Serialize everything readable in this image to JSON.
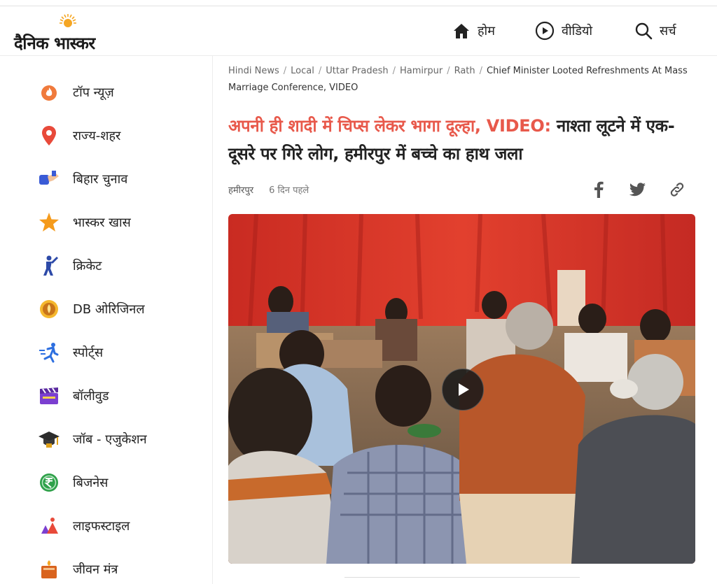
{
  "logo": {
    "text": "दैनिक भास्कर"
  },
  "nav": [
    {
      "label": "होम",
      "icon": "home-icon"
    },
    {
      "label": "वीडियो",
      "icon": "play-circle-icon"
    },
    {
      "label": "सर्च",
      "icon": "search-icon"
    }
  ],
  "sidebar": {
    "items": [
      {
        "label": "टॉप न्यूज़",
        "icon": "fire-icon"
      },
      {
        "label": "राज्य-शहर",
        "icon": "location-pin-icon"
      },
      {
        "label": "बिहार चुनाव",
        "icon": "election-hand-icon"
      },
      {
        "label": "भास्कर खास",
        "icon": "star-icon"
      },
      {
        "label": "क्रिकेट",
        "icon": "cricket-icon"
      },
      {
        "label": "DB ओरिजिनल",
        "icon": "db-original-icon"
      },
      {
        "label": "स्पोर्ट्स",
        "icon": "runner-icon"
      },
      {
        "label": "बॉलीवुड",
        "icon": "clapperboard-icon"
      },
      {
        "label": "जॉब - एजुकेशन",
        "icon": "graduation-cap-icon"
      },
      {
        "label": "बिजनेस",
        "icon": "rupee-icon"
      },
      {
        "label": "लाइफस्टाइल",
        "icon": "lifestyle-icon"
      },
      {
        "label": "जीवन मंत्र",
        "icon": "book-icon"
      }
    ]
  },
  "breadcrumb": {
    "items": [
      "Hindi News",
      "Local",
      "Uttar Pradesh",
      "Hamirpur",
      "Rath"
    ],
    "current": "Chief Minister Looted Refreshments At Mass Marriage Conference, VIDEO"
  },
  "article": {
    "headline_highlight": "अपनी ही शादी में चिप्स लेकर भागा दूल्हा, VIDEO:",
    "headline_rest": " नाश्ता लूटने में एक-दूसरे पर गिरे लोग, हमीरपुर में बच्चे का हाथ जला",
    "location": "हमीरपुर",
    "time": "6 दिन पहले"
  },
  "share": [
    "facebook-icon",
    "twitter-icon",
    "link-icon"
  ],
  "colors": {
    "headline_accent": "#e8594b",
    "logo_sun": "#f5a623",
    "curtain": "#d8322a"
  }
}
